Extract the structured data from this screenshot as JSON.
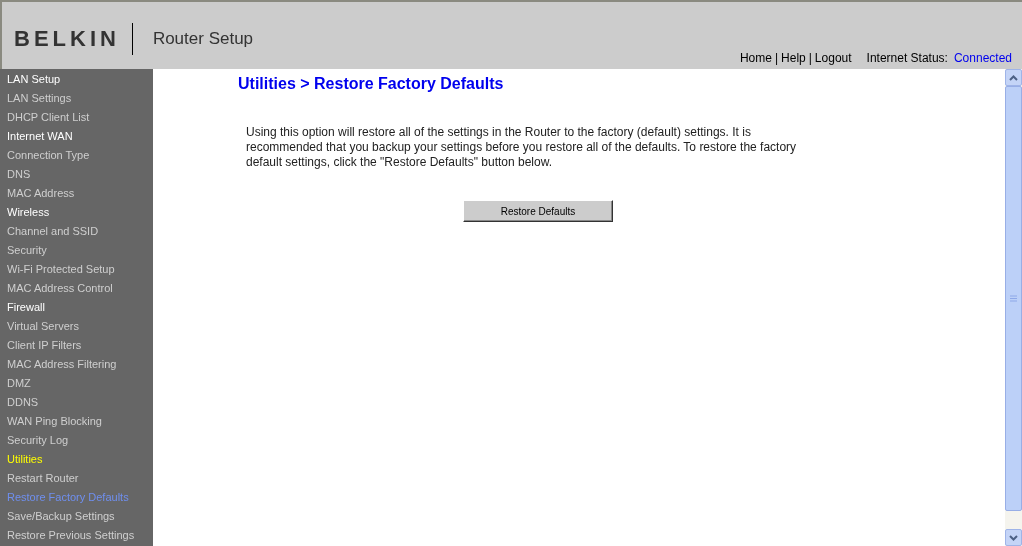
{
  "header": {
    "logo": "BELKIN",
    "title": "Router Setup",
    "nav_links": [
      "Home",
      "Help",
      "Logout"
    ],
    "nav_separator": "|",
    "status_label": "Internet Status:",
    "status_value": "Connected"
  },
  "sidebar": {
    "items": [
      {
        "label": "LAN Setup",
        "kind": "heading",
        "selected": false
      },
      {
        "label": "LAN Settings",
        "kind": "link",
        "selected": false
      },
      {
        "label": "DHCP Client List",
        "kind": "link",
        "selected": false
      },
      {
        "label": "Internet WAN",
        "kind": "heading",
        "selected": false
      },
      {
        "label": "Connection Type",
        "kind": "link",
        "selected": false
      },
      {
        "label": "DNS",
        "kind": "link",
        "selected": false
      },
      {
        "label": "MAC Address",
        "kind": "link",
        "selected": false
      },
      {
        "label": "Wireless",
        "kind": "heading",
        "selected": false
      },
      {
        "label": "Channel and SSID",
        "kind": "link",
        "selected": false
      },
      {
        "label": "Security",
        "kind": "link",
        "selected": false
      },
      {
        "label": "Wi-Fi Protected Setup",
        "kind": "link",
        "selected": false
      },
      {
        "label": "MAC Address Control",
        "kind": "link",
        "selected": false
      },
      {
        "label": "Firewall",
        "kind": "heading",
        "selected": false
      },
      {
        "label": "Virtual Servers",
        "kind": "link",
        "selected": false
      },
      {
        "label": "Client IP Filters",
        "kind": "link",
        "selected": false
      },
      {
        "label": "MAC Address Filtering",
        "kind": "link",
        "selected": false
      },
      {
        "label": "DMZ",
        "kind": "link",
        "selected": false
      },
      {
        "label": "DDNS",
        "kind": "link",
        "selected": false
      },
      {
        "label": "WAN Ping Blocking",
        "kind": "link",
        "selected": false
      },
      {
        "label": "Security Log",
        "kind": "link",
        "selected": false
      },
      {
        "label": "Utilities",
        "kind": "heading",
        "selected": true
      },
      {
        "label": "Restart Router",
        "kind": "link",
        "selected": false
      },
      {
        "label": "Restore Factory Defaults",
        "kind": "link",
        "selected": true
      },
      {
        "label": "Save/Backup Settings",
        "kind": "link",
        "selected": false
      },
      {
        "label": "Restore Previous Settings",
        "kind": "link",
        "selected": false
      }
    ]
  },
  "content": {
    "title": "Utilities > Restore Factory Defaults",
    "description": "Using this option will restore all of the settings in the Router to the factory (default) settings. It is recommended that you backup your settings before you restore all of the defaults. To restore the factory default settings, click the \"Restore Defaults\" button below.",
    "button": "Restore Defaults"
  }
}
